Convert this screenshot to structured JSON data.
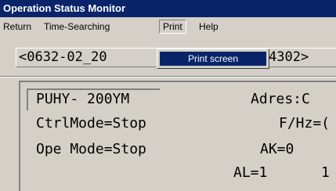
{
  "window": {
    "title": "Operation Status Monitor"
  },
  "menu": {
    "items": [
      "Return",
      "Time-Searching",
      "Print",
      "Help"
    ],
    "open_menu": "Print",
    "dropdown": {
      "items": [
        "Print screen"
      ],
      "highlighted": "Print screen"
    }
  },
  "address": {
    "left_text": "<0632-02_20",
    "right_text": "4302>"
  },
  "status": {
    "model": "PUHY- 200YM",
    "adres": "Adres:C",
    "ctrl_mode": "CtrlMode=Stop",
    "fhz": "F/Hz=(",
    "ope_mode": "Ope Mode=Stop",
    "ak": "AK=0",
    "al": "AL=1",
    "trailing": "1"
  },
  "colors": {
    "titlebar": "#0a246a",
    "highlight": "#0a246a",
    "face": "#d4d0c8"
  }
}
